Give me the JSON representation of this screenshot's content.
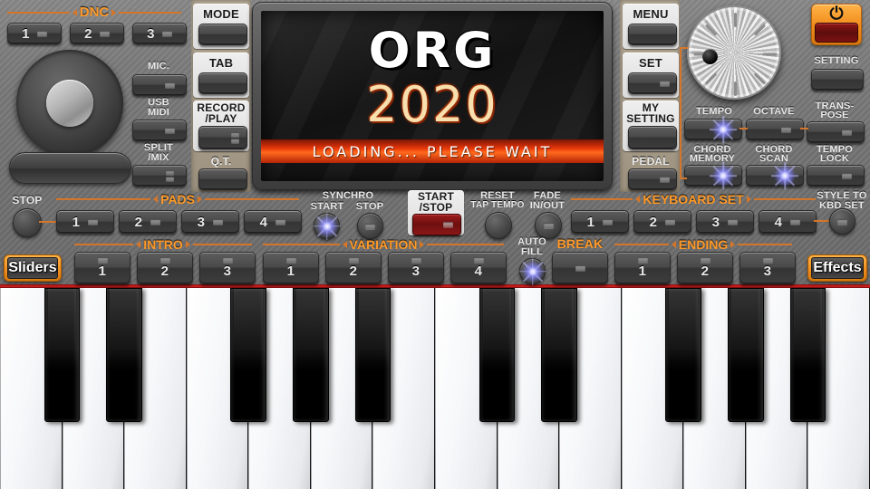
{
  "app": {
    "title": "ORG 2020"
  },
  "display": {
    "brand": "ORG",
    "year": "2020",
    "status": "LOADING... PLEASE WAIT"
  },
  "left_section": {
    "dnc_group": "DNC",
    "dnc_buttons": [
      "1",
      "2",
      "3"
    ],
    "side_labels": [
      "MIC.",
      "USB\nMIDI",
      "SPLIT\n/MIX"
    ],
    "mic_label": "MIC.",
    "usb_midi_label_1": "USB",
    "usb_midi_label_2": "MIDI",
    "split_mix_label_1": "SPLIT",
    "split_mix_label_2": "/MIX"
  },
  "mode_column": {
    "mode_label": "MODE",
    "tab_label": "TAB",
    "record_play_label_1": "RECORD",
    "record_play_label_2": "/PLAY",
    "qt_label": "Q.T."
  },
  "menu_column": {
    "menu_label": "MENU",
    "set_label": "SET",
    "my_setting_label_1": "MY",
    "my_setting_label_2": "SETTING",
    "pedal_label": "PEDAL"
  },
  "right_section": {
    "power_glyph": "⏻",
    "setting_label": "SETTING",
    "tempo_label": "TEMPO",
    "octave_label": "OCTAVE",
    "transpose_label_1": "TRANS-",
    "transpose_label_2": "POSE",
    "chord_memory_label_1": "CHORD",
    "chord_memory_label_2": "MEMORY",
    "chord_scan_label_1": "CHORD",
    "chord_scan_label_2": "SCAN",
    "tempo_lock_label_1": "TEMPO",
    "tempo_lock_label_2": "LOCK"
  },
  "transport": {
    "stop_label": "STOP",
    "pads_group": "PADS",
    "pad_buttons": [
      "1",
      "2",
      "3",
      "4"
    ],
    "synchro_label": "SYNCHRO",
    "synchro_start_label": "START",
    "synchro_stop_label": "STOP",
    "start_stop_label_1": "START",
    "start_stop_label_2": "/STOP",
    "reset_label": "RESET",
    "tap_tempo_label": "TAP TEMPO",
    "fade_label_1": "FADE",
    "fade_label_2": "IN/OUT",
    "keyboard_set_group": "KEYBOARD SET",
    "keyboard_set_buttons": [
      "1",
      "2",
      "3",
      "4"
    ],
    "style_to_kbd_label_1": "STYLE TO",
    "style_to_kbd_label_2": "KBD SET"
  },
  "style_row": {
    "sliders_label": "Sliders",
    "effects_label": "Effects",
    "intro_group": "INTRO",
    "intro_buttons": [
      "1",
      "2",
      "3"
    ],
    "variation_group": "VARIATION",
    "variation_buttons": [
      "1",
      "2",
      "3",
      "4"
    ],
    "auto_fill_label_1": "AUTO",
    "auto_fill_label_2": "FILL",
    "break_group": "BREAK",
    "break_button": "",
    "ending_group": "ENDING",
    "ending_buttons": [
      "1",
      "2",
      "3"
    ]
  },
  "colors": {
    "accent_orange": "#ff9a28",
    "rule_orange": "#d4762a",
    "panel_gray": "#7d7d7d",
    "led_blue": "#9b9bff",
    "red_bar": "#e8370a",
    "power_orange": "#f08a1a"
  },
  "keyboard": {
    "white_key_count": 14,
    "black_key_count": 10
  }
}
